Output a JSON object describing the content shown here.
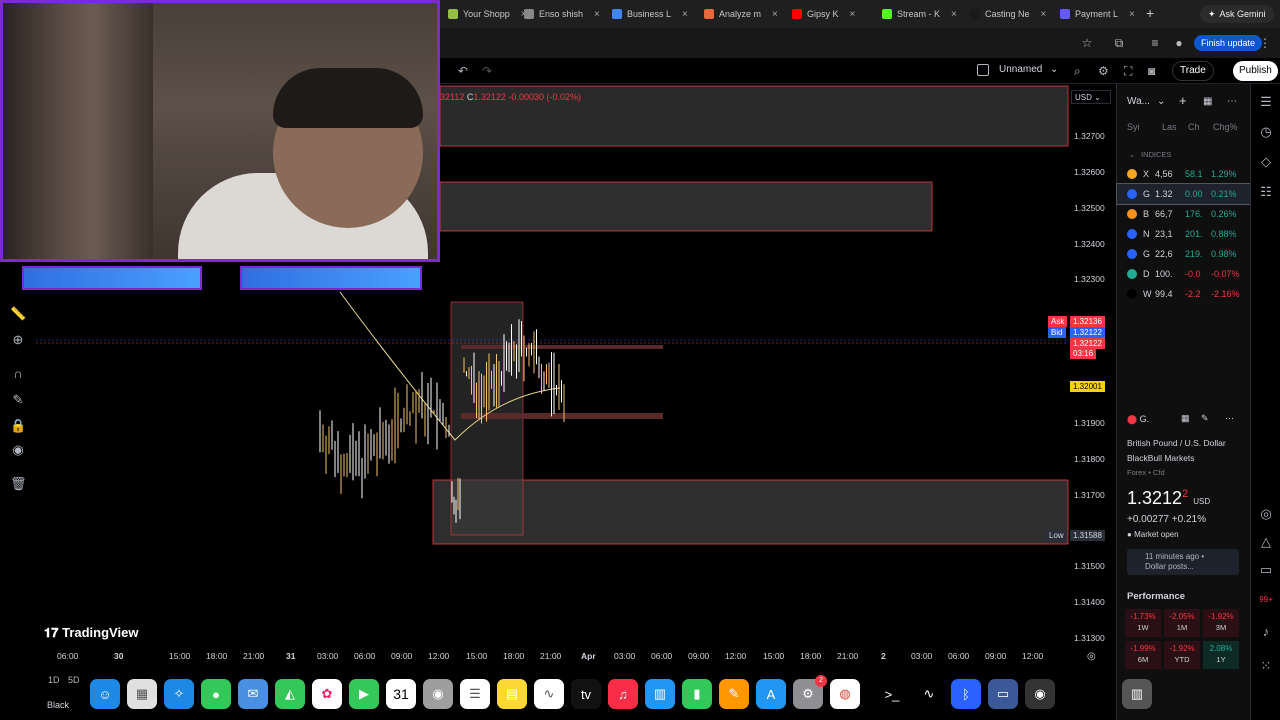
{
  "browser": {
    "tabs": [
      {
        "label": "Your Shopp",
        "color": "#95bf47"
      },
      {
        "label": "Enso shish",
        "color": "#888888"
      },
      {
        "label": "Business L",
        "color": "#4285f4"
      },
      {
        "label": "Analyze m",
        "color": "#e8673c"
      },
      {
        "label": "Gipsy K",
        "color": "#ff0000"
      },
      {
        "label": "Stream - K",
        "color": "#53fc18"
      },
      {
        "label": "Casting Ne",
        "color": "#1a1a1a"
      },
      {
        "label": "Payment L",
        "color": "#635bff"
      }
    ],
    "new_tab": "+",
    "ask_gemini": "Ask Gemini",
    "finish_update": "Finish update"
  },
  "toolbar": {
    "layout_name": "Unnamed",
    "trade": "Trade",
    "publish": "Publish"
  },
  "ohlc": {
    "close_partial": "32112",
    "close_label": "C",
    "close": "1.32122",
    "change": "-0.00030 (-0.02%)"
  },
  "chart": {
    "currency": "USD",
    "price_labels": [
      "1.32700",
      "1.32600",
      "1.32500",
      "1.32400",
      "1.32300",
      "1.31900",
      "1.31800",
      "1.31700",
      "1.31500",
      "1.31400",
      "1.31300"
    ],
    "ask_label": "Ask",
    "ask": "1.32136",
    "bid_label": "Bid",
    "bid": "1.32122",
    "last": "1.32122",
    "countdown": "03:16",
    "level": "1.32001",
    "low_label": "Low",
    "low": "1.31588",
    "time_labels": [
      "06:00",
      "30",
      "15:00",
      "18:00",
      "21:00",
      "31",
      "03:00",
      "06:00",
      "09:00",
      "12:00",
      "15:00",
      "18:00",
      "21:00",
      "Apr",
      "03:00",
      "06:00",
      "09:00",
      "12:00",
      "15:00",
      "18:00",
      "21:00",
      "2",
      "03:00",
      "06:00",
      "09:00",
      "12:00"
    ],
    "logo": "TradingView",
    "ranges": [
      "1D",
      "5D"
    ],
    "colors": {
      "up": "#f5c26b",
      "down": "#ffffff",
      "ma": "#e6d98a",
      "zone_border": "#f23645"
    }
  },
  "watchlist": {
    "title": "Wa...",
    "columns": [
      "Syi",
      "Las",
      "Ch",
      "Chg%"
    ],
    "section": "INDICES",
    "rows": [
      {
        "sym": "X",
        "last": "4,56",
        "chg": "58.1",
        "pct": "1.29%",
        "dir": "up",
        "color": "#f5a623"
      },
      {
        "sym": "G",
        "last": "1.32",
        "chg": "0.00",
        "pct": "0.21%",
        "dir": "up",
        "color": "#2962ff"
      },
      {
        "sym": "B",
        "last": "66,7",
        "chg": "176.",
        "pct": "0.26%",
        "dir": "up",
        "color": "#f7931a"
      },
      {
        "sym": "N",
        "last": "23,1",
        "chg": "201.",
        "pct": "0.88%",
        "dir": "up",
        "color": "#2962ff"
      },
      {
        "sym": "G",
        "last": "22,6",
        "chg": "219.",
        "pct": "0.98%",
        "dir": "up",
        "color": "#2962ff"
      },
      {
        "sym": "D",
        "last": "100.",
        "chg": "-0.0",
        "pct": "-0.07%",
        "dir": "down",
        "color": "#22ab94"
      },
      {
        "sym": "W",
        "last": "99.4",
        "chg": "-2.2",
        "pct": "-2.16%",
        "dir": "down",
        "color": "#000000"
      }
    ]
  },
  "details": {
    "symbol": "G.",
    "name": "British Pound / U.S. Dollar",
    "broker": "BlackBull Markets",
    "type": "Forex • Cfd",
    "price": "1.3212",
    "price_last_digit": "2",
    "currency": "USD",
    "change": "+0.00277",
    "change_pct": "+0.21%",
    "market_status": "Market open",
    "news_time": "11 minutes ago •",
    "news_text": "Dollar posts...",
    "performance_title": "Performance",
    "performance": [
      {
        "value": "-1.73%",
        "label": "1W",
        "dir": "down"
      },
      {
        "value": "-2.05%",
        "label": "1M",
        "dir": "down"
      },
      {
        "value": "-1.92%",
        "label": "3M",
        "dir": "down"
      },
      {
        "value": "-1.99%",
        "label": "6M",
        "dir": "down"
      },
      {
        "value": "-1.92%",
        "label": "YTD",
        "dir": "down"
      },
      {
        "value": "2.08%",
        "label": "1Y",
        "dir": "up"
      }
    ]
  },
  "dock": {
    "label": "Black",
    "badge_settings": "2",
    "badge_right": "99+"
  }
}
